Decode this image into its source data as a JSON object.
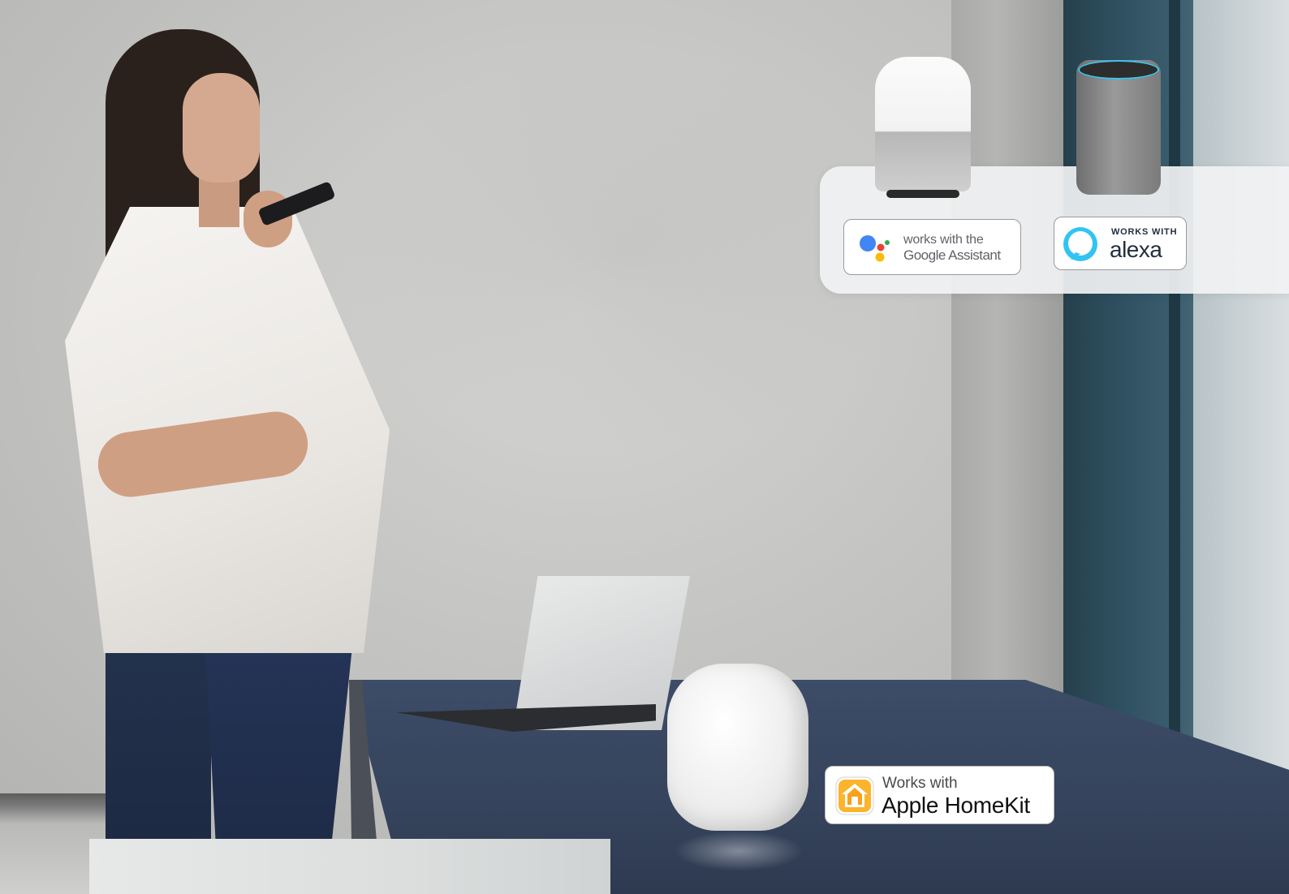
{
  "badges": {
    "google": {
      "line1": "works with the",
      "line2": "Google Assistant"
    },
    "alexa": {
      "line1": "WORKS WITH",
      "line2": "alexa"
    },
    "homekit": {
      "line1": "Works with",
      "line2": "Apple HomeKit"
    }
  },
  "colors": {
    "google_blue": "#4285F4",
    "google_red": "#EA4335",
    "google_yellow": "#FBBC05",
    "google_green": "#34A853",
    "alexa_blue": "#31C4F3",
    "homekit_orange": "#F7A21B",
    "desk": "#35435c"
  },
  "icons": [
    "google-assistant-dots-icon",
    "alexa-ring-icon",
    "apple-home-icon"
  ]
}
